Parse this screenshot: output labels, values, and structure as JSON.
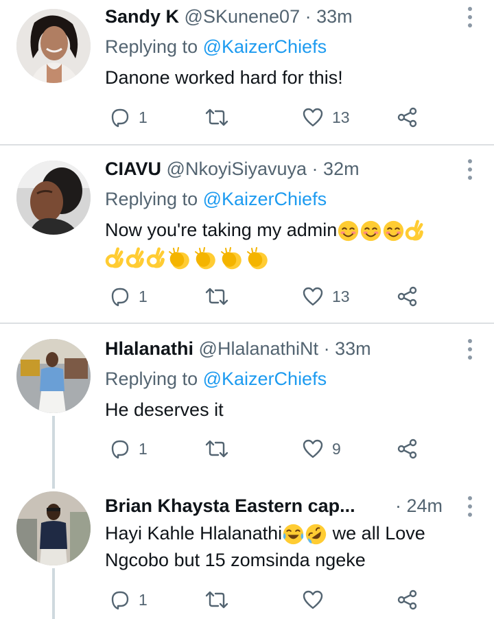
{
  "tweets": [
    {
      "name": "Sandy K",
      "handle": "@SKunene07",
      "dot": "·",
      "time": "33m",
      "replying_prefix": "Replying to",
      "replying_to": "@KaizerChiefs",
      "text": "Danone worked hard for this!",
      "replies": "1",
      "likes": "13"
    },
    {
      "name": "CIAVU",
      "handle": "@NkoyiSiyavuya",
      "dot": "·",
      "time": "32m",
      "replying_prefix": "Replying to",
      "replying_to": "@KaizerChiefs",
      "text_line1": "Now you're taking my admin",
      "emojis_line1": [
        "smiling-face-with-smiling-eyes",
        "smiling-face-with-smiling-eyes",
        "smiling-face-with-smiling-eyes",
        "ok-hand"
      ],
      "emojis_line2": [
        "ok-hand",
        "ok-hand",
        "ok-hand",
        "clapping-hands",
        "clapping-hands",
        "clapping-hands",
        "clapping-hands"
      ],
      "replies": "1",
      "likes": "13"
    },
    {
      "name": "Hlalanathi",
      "handle": "@HlalanathiNt",
      "dot": "·",
      "time": "33m",
      "replying_prefix": "Replying to",
      "replying_to": "@KaizerChiefs",
      "text": "He deserves it",
      "replies": "1",
      "likes": "9"
    },
    {
      "name": "Brian Khaysta Eastern cap...",
      "dot": "·",
      "time": "24m",
      "text_line1": "Hayi Kahle Hlalanathi",
      "emojis_line1": [
        "face-with-tears-of-joy",
        "rolling-on-the-floor-laughing"
      ],
      "text_line1_tail": " we all Love",
      "text_line2": "Ngcobo but 15 zomsinda ngeke",
      "replies": "1",
      "likes": ""
    }
  ],
  "colors": {
    "link": "#1d9bf0",
    "secondary": "#536471",
    "divider": "#dcdfe2",
    "thread_line": "#cfd9de",
    "emoji_yellow": "#ffcc33"
  }
}
